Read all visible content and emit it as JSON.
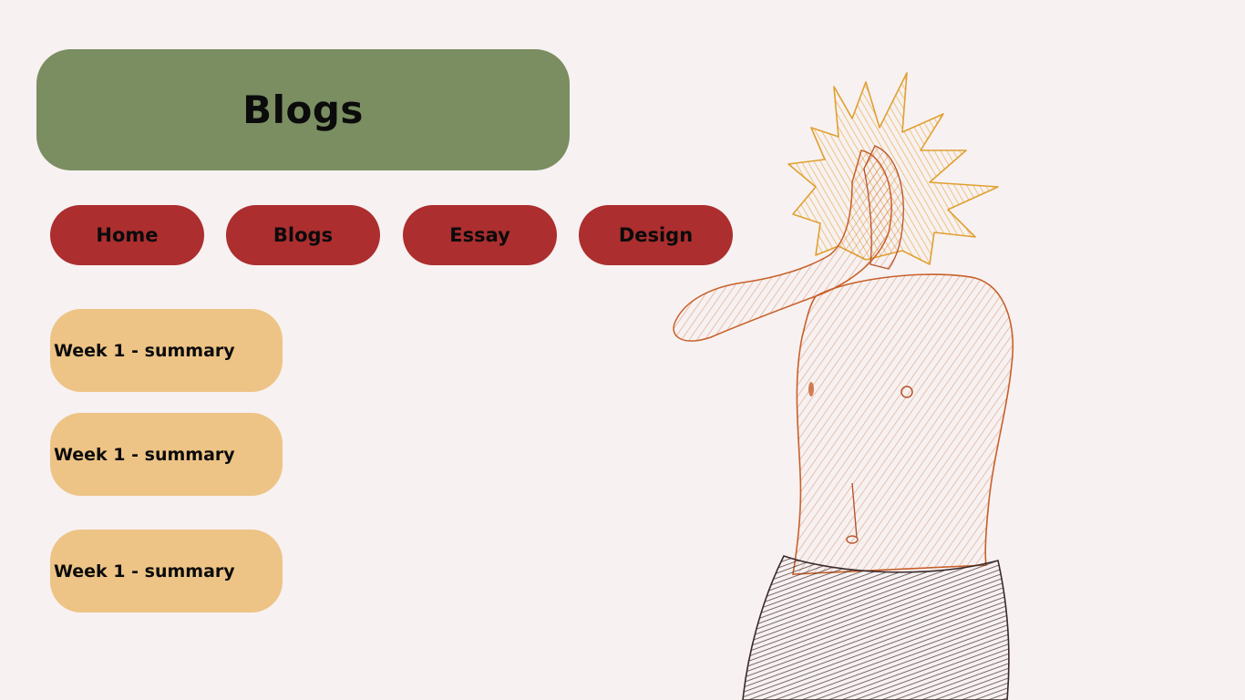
{
  "header": {
    "title": "Blogs"
  },
  "nav": {
    "items": [
      {
        "label": "Home"
      },
      {
        "label": "Blogs"
      },
      {
        "label": "Essay"
      },
      {
        "label": "Design"
      }
    ]
  },
  "posts": [
    {
      "title": "Week 1 - summary"
    },
    {
      "title": "Week 1 - summary"
    },
    {
      "title": "Week 1 - summary"
    }
  ],
  "colors": {
    "background": "#f7f1f1",
    "title_banner": "#7a8e61",
    "nav_button": "#ac2e2f",
    "post_card": "#edc486",
    "hair": "#f0b233",
    "skin_lines": "#c8602a",
    "shorts": "#4a3333"
  },
  "illustration": {
    "subject": "pencil-sketch-figure"
  }
}
